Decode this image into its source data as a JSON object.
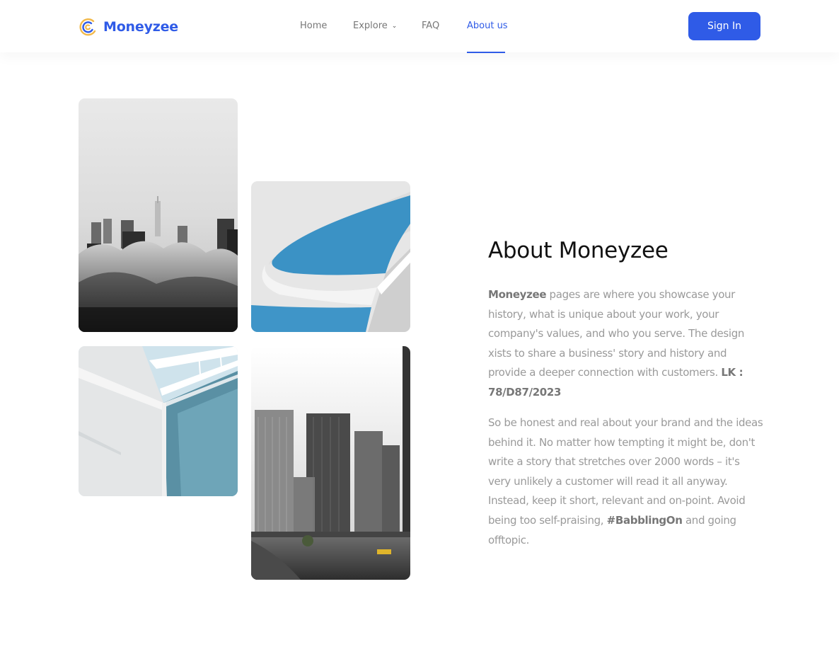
{
  "brand": {
    "name": "Moneyzee",
    "accent": "#2f5be7"
  },
  "nav": {
    "home": "Home",
    "explore": "Explore",
    "faq": "FAQ",
    "about": "About us",
    "active": "About us"
  },
  "header": {
    "signin_label": "Sign In"
  },
  "gallery": [
    {
      "label": "foggy-city-skyline-photo"
    },
    {
      "label": "blue-curved-architecture-photo"
    },
    {
      "label": "glass-balcony-architecture-photo"
    },
    {
      "label": "city-river-skyscrapers-photo"
    }
  ],
  "about": {
    "title": "About Moneyzee",
    "p1_brand": "Moneyzee",
    "p1_text": " pages are where you showcase your history, what is unique about your work, your company's values, and who you serve. The design xists to share a business' story and history and provide a deeper connection with customers. ",
    "p1_code": "LK : 78/D87/2023",
    "p2_text": "So be honest and real about your brand and the ideas behind it. No matter how tempting it might be, don't write a story that stretches over 2000 words – it's very unlikely a customer will read it all anyway. Instead, keep it short, relevant and on-point. Avoid being too self-praising, ",
    "p2_tag": "#BabblingOn",
    "p2_end": " and going offtopic."
  }
}
